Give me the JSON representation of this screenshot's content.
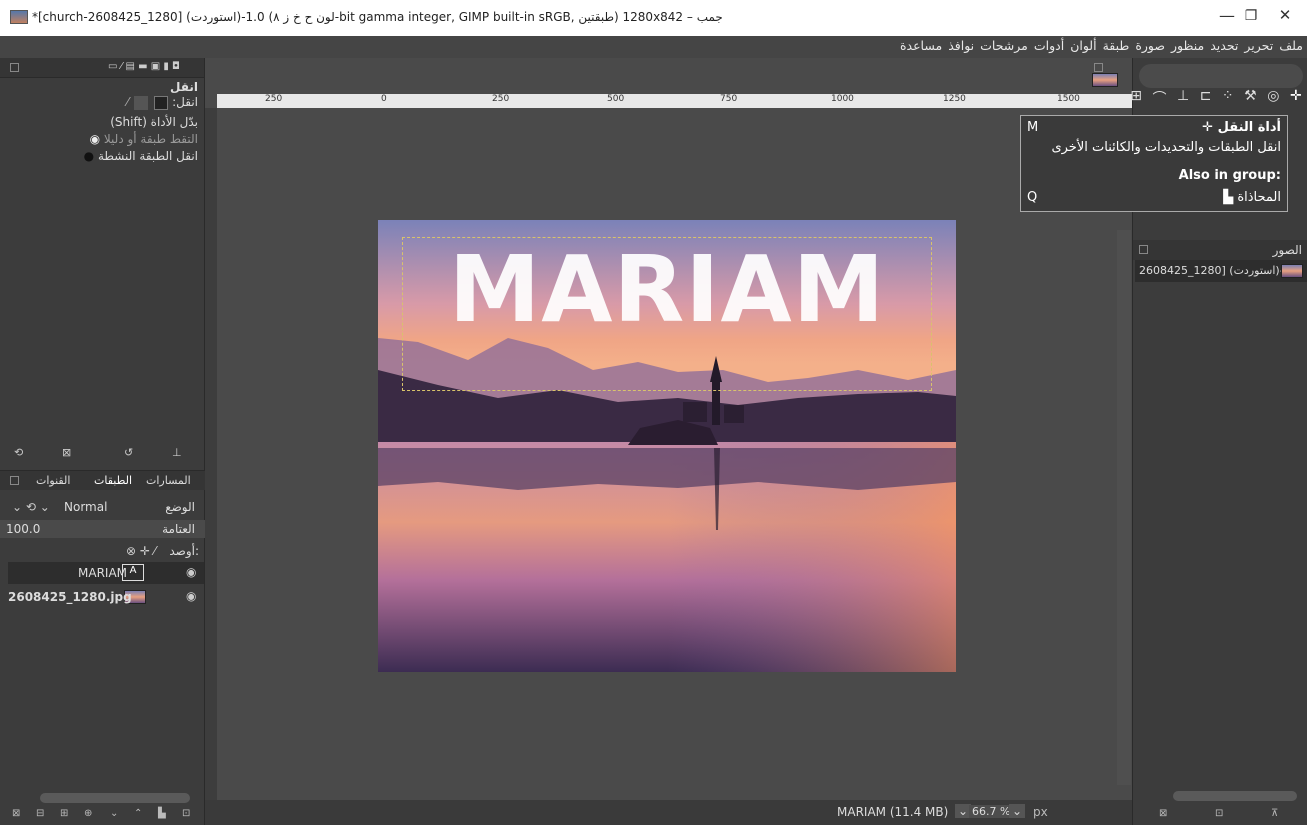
{
  "window": {
    "title": "*[church-2608425_1280] (استوردت)-1.0 (لون ح خ ز ٨-bit gamma integer, GIMP built-in sRGB, طبقتين) 1280x842 – جمب",
    "minimize": "—",
    "maximize": "❐",
    "close": "✕"
  },
  "menu": {
    "items": [
      "ملف",
      "تحرير",
      "تحديد",
      "منظور",
      "صورة",
      "طبقة",
      "ألوان",
      "أدوات",
      "مرشحات",
      "نوافذ",
      "مساعدة"
    ]
  },
  "tool_options": {
    "title": "انقل",
    "move_label": "انقل:",
    "toggle_label": "بدّل الأداة (Shift)",
    "option_pick": "التقط طبقة أو دليلا",
    "option_active": "انقل الطبقة النشطة"
  },
  "layers_panel": {
    "tabs": [
      "المسارات",
      "الطبقات",
      "القنوات"
    ],
    "mode_label": "الوضع",
    "mode_value": "Normal",
    "opacity_label": "العتامة",
    "opacity_value": "100.0",
    "lock_label": "أوصد:",
    "layers": [
      {
        "name": "MARIAM",
        "type": "text"
      },
      {
        "name": "2608425_1280.jpg",
        "type": "image"
      }
    ]
  },
  "ruler": {
    "ticks": [
      "250",
      "0",
      "250",
      "500",
      "750",
      "1000",
      "1250",
      "1500"
    ]
  },
  "canvas": {
    "text_layer": "MARIAM"
  },
  "status": {
    "layer_info": "MARIAM (11.4 MB)",
    "zoom": "66.7 %",
    "unit": "px"
  },
  "tooltip": {
    "title": "أداة النقل",
    "shortcut": "M",
    "description": "انقل الطبقات والتحديدات والكائنات الأخرى",
    "group_label": "Also in group:",
    "group_item": "المحاذاة",
    "group_shortcut": "Q"
  },
  "images_panel": {
    "title": "الصور",
    "item": "2608425_1280] (استوردت)-1"
  }
}
